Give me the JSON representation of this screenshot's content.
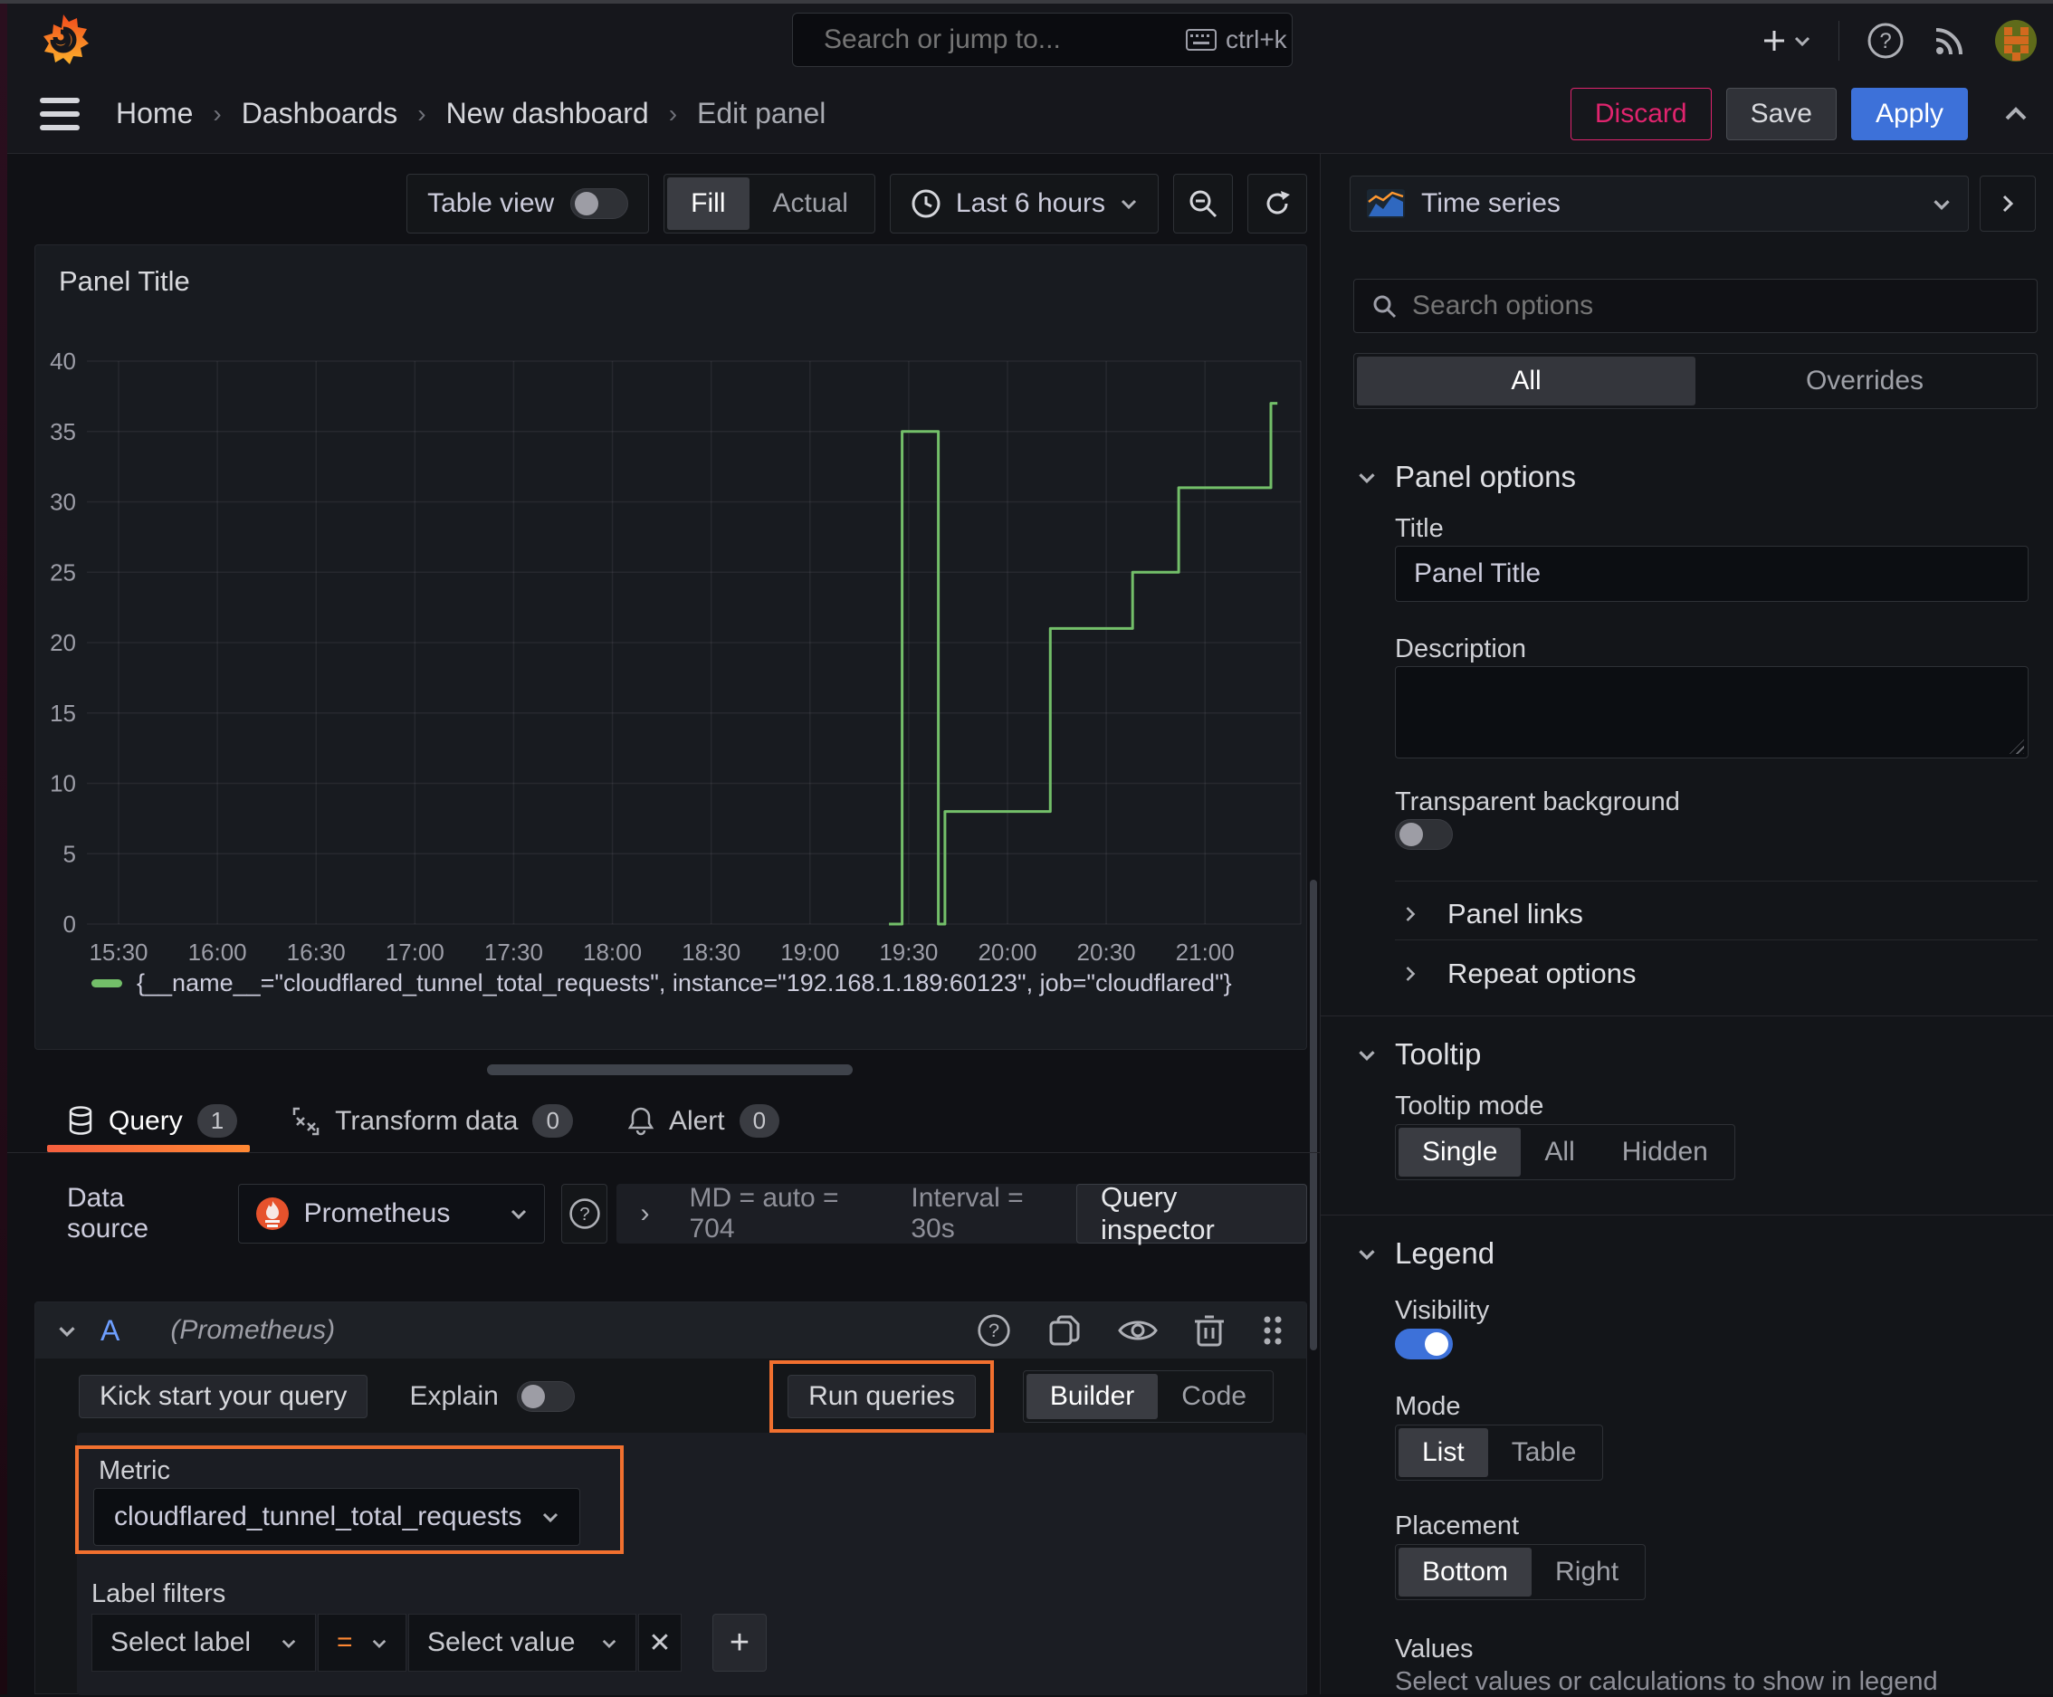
{
  "topbar": {
    "search_placeholder": "Search or jump to...",
    "shortcut": "ctrl+k"
  },
  "breadcrumb": {
    "items": [
      "Home",
      "Dashboards",
      "New dashboard",
      "Edit panel"
    ],
    "discard": "Discard",
    "save": "Save",
    "apply": "Apply"
  },
  "toolbar": {
    "table_view": "Table view",
    "fill": "Fill",
    "actual": "Actual",
    "time_range": "Last 6 hours"
  },
  "panel": {
    "title": "Panel Title"
  },
  "chart_data": {
    "type": "line",
    "title": "Panel Title",
    "line_color": "#73bf69",
    "grid": true,
    "legend_position": "bottom",
    "ylim": [
      0,
      40
    ],
    "y_ticks": [
      0,
      5,
      10,
      15,
      20,
      25,
      30,
      35,
      40
    ],
    "x_ticks": [
      {
        "m": 0,
        "label": "15:30"
      },
      {
        "m": 30,
        "label": "16:00"
      },
      {
        "m": 60,
        "label": "16:30"
      },
      {
        "m": 90,
        "label": "17:00"
      },
      {
        "m": 120,
        "label": "17:30"
      },
      {
        "m": 150,
        "label": "18:00"
      },
      {
        "m": 180,
        "label": "18:30"
      },
      {
        "m": 210,
        "label": "19:00"
      },
      {
        "m": 240,
        "label": "19:30"
      },
      {
        "m": 270,
        "label": "20:00"
      },
      {
        "m": 300,
        "label": "20:30"
      },
      {
        "m": 330,
        "label": "21:00"
      }
    ],
    "series": [
      {
        "name": "{__name__=\"cloudflared_tunnel_total_requests\", instance=\"192.168.1.189:60123\", job=\"cloudflared\"}",
        "color": "#73bf69",
        "points_minute_value": [
          [
            234,
            0
          ],
          [
            238,
            0
          ],
          [
            238,
            35
          ],
          [
            249,
            35
          ],
          [
            249,
            0
          ],
          [
            251,
            0
          ],
          [
            251,
            8
          ],
          [
            283,
            8
          ],
          [
            283,
            21
          ],
          [
            308,
            21
          ],
          [
            308,
            25
          ],
          [
            322,
            25
          ],
          [
            322,
            31
          ],
          [
            350,
            31
          ],
          [
            350,
            37
          ],
          [
            352,
            37
          ]
        ]
      }
    ]
  },
  "tabs": {
    "query": "Query",
    "query_count": "1",
    "transform": "Transform data",
    "transform_count": "0",
    "alert": "Alert",
    "alert_count": "0"
  },
  "datasource_row": {
    "label": "Data source",
    "name": "Prometheus",
    "stats_md": "MD = auto = 704",
    "stats_interval": "Interval = 30s",
    "query_inspector": "Query inspector"
  },
  "query_editor": {
    "ref_id": "A",
    "ds_hint": "(Prometheus)",
    "kick_start": "Kick start your query",
    "explain": "Explain",
    "run_queries": "Run queries",
    "builder": "Builder",
    "code": "Code",
    "metric_label": "Metric",
    "metric_value": "cloudflared_tunnel_total_requests",
    "label_filters": "Label filters",
    "select_label": "Select label",
    "operator": "=",
    "select_value": "Select value",
    "remove": "✕",
    "add": "+"
  },
  "options": {
    "viz_name": "Time series",
    "search_placeholder": "Search options",
    "tab_all": "All",
    "tab_overrides": "Overrides",
    "panel_options": {
      "title": "Panel options",
      "title_label": "Title",
      "title_value": "Panel Title",
      "description_label": "Description",
      "transparent_label": "Transparent background"
    },
    "collapsed": [
      "Panel links",
      "Repeat options"
    ],
    "tooltip": {
      "title": "Tooltip",
      "mode_label": "Tooltip mode",
      "modes": [
        "Single",
        "All",
        "Hidden"
      ],
      "selected": "Single"
    },
    "legend": {
      "title": "Legend",
      "visibility_label": "Visibility",
      "mode_label": "Mode",
      "modes": [
        "List",
        "Table"
      ],
      "selected_mode": "List",
      "placement_label": "Placement",
      "placements": [
        "Bottom",
        "Right"
      ],
      "selected_placement": "Bottom",
      "values_label": "Values",
      "values_hint": "Select values or calculations to show in legend"
    }
  },
  "colors": {
    "accent_orange": "#ff8833",
    "annotation_orange": "#f1702f",
    "apply_blue": "#3d71d9",
    "discard_pink": "#e0246e",
    "series_green": "#73bf69"
  }
}
